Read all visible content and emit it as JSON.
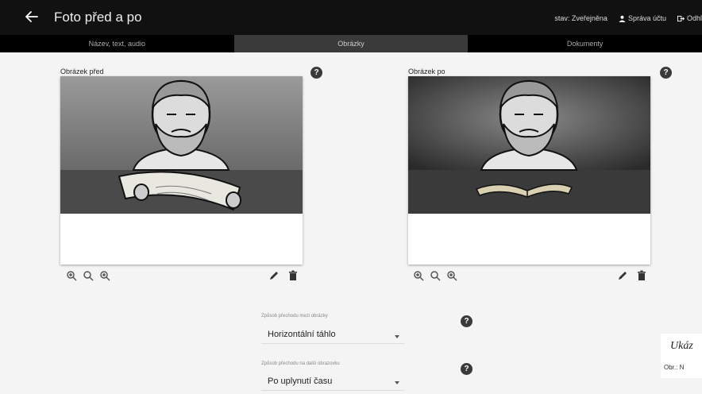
{
  "header": {
    "title": "Foto před a po",
    "status": "stav: Zveřejněna",
    "account": "Správa účtu",
    "logout": "Odhl"
  },
  "tabs": [
    {
      "label": "Název, text, audio",
      "active": false
    },
    {
      "label": "Obrázky",
      "active": true
    },
    {
      "label": "Dokumenty",
      "active": false
    }
  ],
  "before": {
    "label": "Obrázek před",
    "help": "?",
    "icons": [
      "zoom-in-icon",
      "zoom-reset-icon",
      "zoom-out-icon",
      "pencil-icon",
      "trash-icon"
    ]
  },
  "after": {
    "label": "Obrázek po",
    "help": "?",
    "icons": [
      "zoom-in-icon",
      "zoom-reset-icon",
      "zoom-out-icon",
      "pencil-icon",
      "trash-icon"
    ]
  },
  "form": {
    "transition_label": "Způsob přechodu mezi obrázky",
    "transition_value": "Horizontální táhlo",
    "next_label": "Způsob přechodu na další obrazovku",
    "next_value": "Po uplynutí času",
    "help": "?"
  },
  "caption": {
    "title": "Ukáz",
    "subtitle": "Obr.: N"
  },
  "colors": {
    "topbar": "#111111",
    "tab_active": "#3a3a3a",
    "help_bg": "#3a3a3a"
  }
}
